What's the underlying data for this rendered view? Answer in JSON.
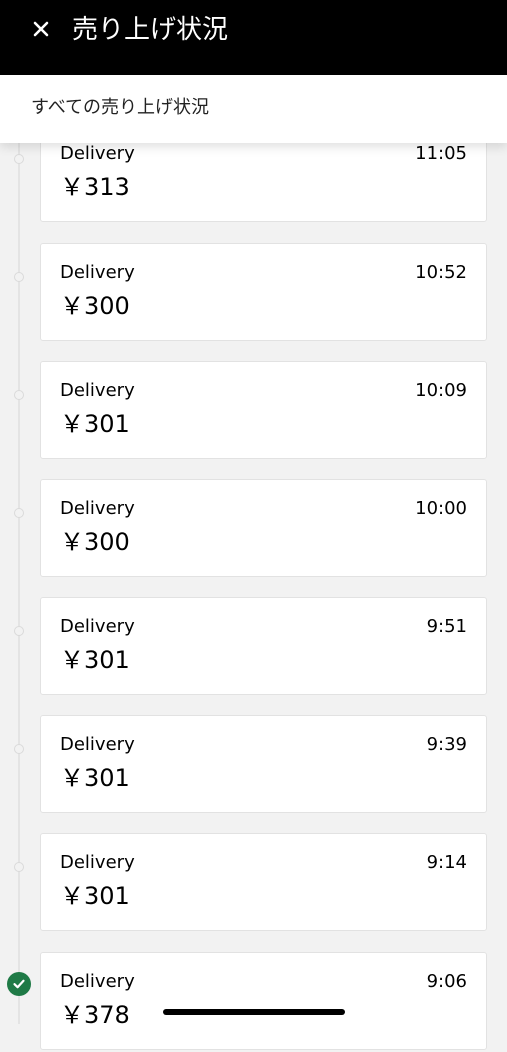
{
  "header": {
    "close_icon": "close-icon",
    "title": "売り上げ状況"
  },
  "filter": {
    "label": "すべての売り上げ状況"
  },
  "deliveries": [
    {
      "type": "Delivery",
      "time": "11:05",
      "amount": "￥313",
      "status": "pending"
    },
    {
      "type": "Delivery",
      "time": "10:52",
      "amount": "￥300",
      "status": "pending"
    },
    {
      "type": "Delivery",
      "time": "10:09",
      "amount": "￥301",
      "status": "pending"
    },
    {
      "type": "Delivery",
      "time": "10:00",
      "amount": "￥300",
      "status": "pending"
    },
    {
      "type": "Delivery",
      "time": "9:51",
      "amount": "￥301",
      "status": "pending"
    },
    {
      "type": "Delivery",
      "time": "9:39",
      "amount": "￥301",
      "status": "pending"
    },
    {
      "type": "Delivery",
      "time": "9:14",
      "amount": "￥301",
      "status": "pending"
    },
    {
      "type": "Delivery",
      "time": "9:06",
      "amount": "￥378",
      "status": "done"
    }
  ],
  "colors": {
    "header_bg": "#000000",
    "check_green": "#1f7a46",
    "page_bg": "#f2f2f2"
  }
}
